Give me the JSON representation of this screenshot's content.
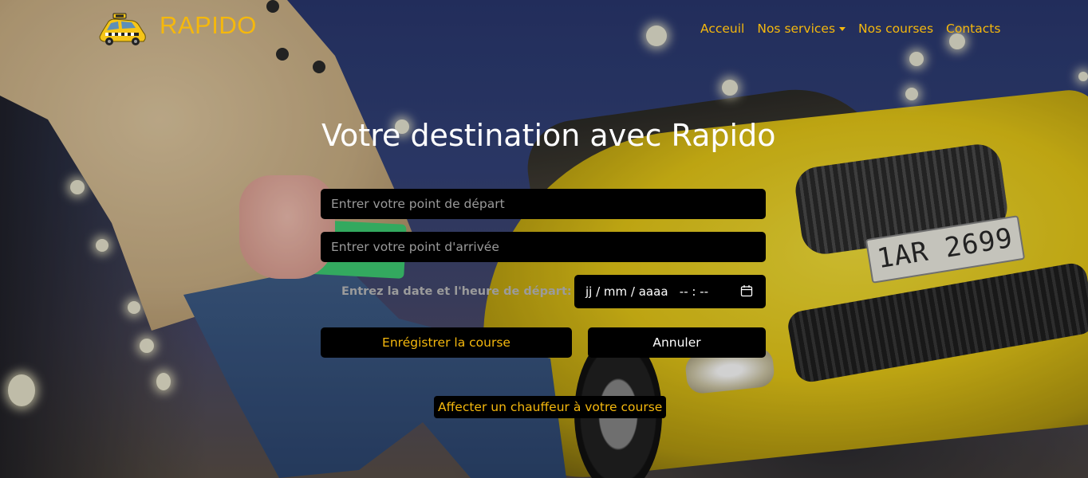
{
  "brand": {
    "name": "RAPIDO",
    "logo_icon": "taxi-icon",
    "accent_color": "#f5b80d"
  },
  "nav": {
    "items": [
      {
        "label": "Acceuil"
      },
      {
        "label": "Nos services",
        "dropdown": true
      },
      {
        "label": "Nos courses"
      },
      {
        "label": "Contacts"
      }
    ]
  },
  "hero": {
    "title": "Votre destination avec Rapido",
    "departure_placeholder": "Entrer votre point de départ",
    "arrival_placeholder": "Entrer votre point d'arrivée",
    "date_label": "Entrez la date et l'heure de départ:",
    "date_value": "jj / mm / aaaa   -- : --",
    "calendar_icon": "calendar-icon",
    "save_label": "Enrégistrer la course",
    "cancel_label": "Annuler",
    "assign_label": "Affecter un chauffeur à votre course"
  },
  "background": {
    "plate_text": "1AR 2699"
  }
}
